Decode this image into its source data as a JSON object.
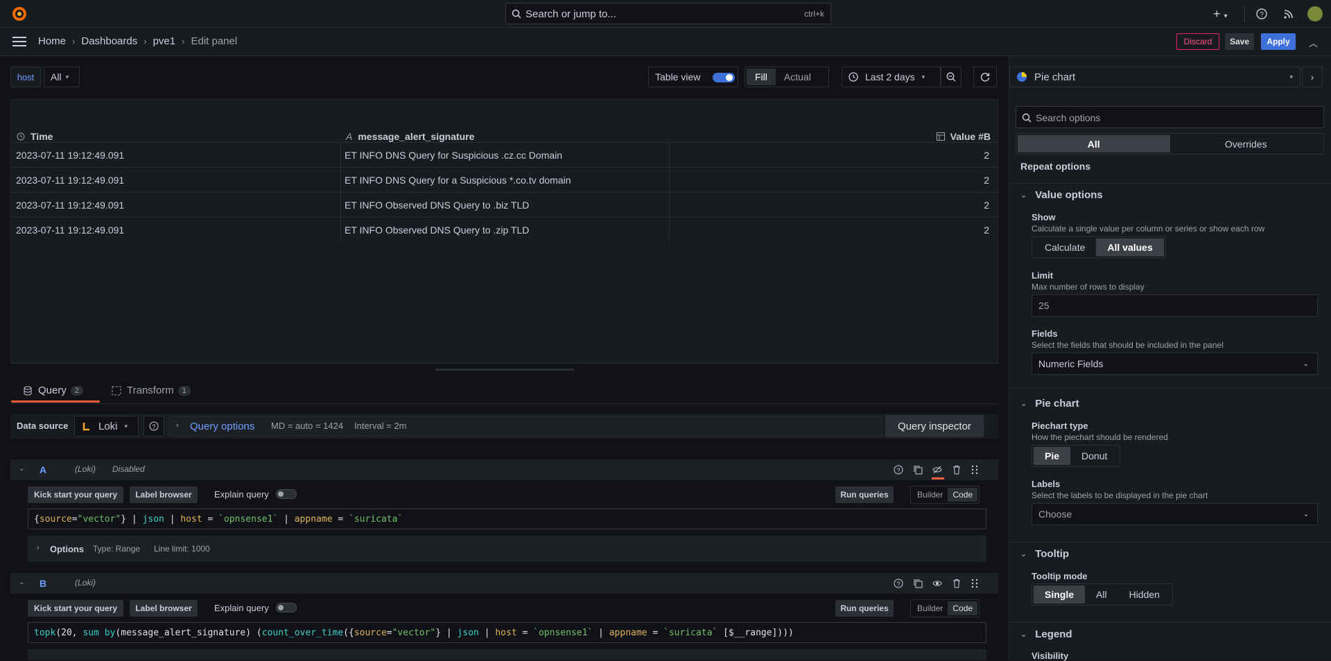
{
  "search": {
    "placeholder": "Search or jump to...",
    "shortcut": "ctrl+k"
  },
  "breadcrumb": {
    "home": "Home",
    "dashboards": "Dashboards",
    "dashboard": "pve1",
    "current": "Edit panel"
  },
  "toolbar": {
    "discard": "Discard",
    "save": "Save",
    "apply": "Apply"
  },
  "panel_controls": {
    "variable_label": "host",
    "variable_value": "All",
    "table_view": "Table view",
    "fill": "Fill",
    "actual": "Actual",
    "time_range": "Last 2 days"
  },
  "table": {
    "columns": [
      "Time",
      "message_alert_signature",
      "Value #B"
    ],
    "rows": [
      [
        "2023-07-11 19:12:49.091",
        "ET INFO DNS Query for Suspicious .cz.cc Domain",
        "2"
      ],
      [
        "2023-07-11 19:12:49.091",
        "ET INFO DNS Query for a Suspicious *.co.tv domain",
        "2"
      ],
      [
        "2023-07-11 19:12:49.091",
        "ET INFO Observed DNS Query to .biz TLD",
        "2"
      ],
      [
        "2023-07-11 19:12:49.091",
        "ET INFO Observed DNS Query to .zip TLD",
        "2"
      ]
    ]
  },
  "query_tabs": {
    "query": "Query",
    "query_count": "2",
    "transform": "Transform",
    "transform_count": "1"
  },
  "datasource": {
    "label": "Data source",
    "name": "Loki",
    "options": "Query options",
    "md": "MD = auto = 1424",
    "interval": "Interval = 2m",
    "inspector": "Query inspector"
  },
  "queries": [
    {
      "letter": "A",
      "source": "(Loki)",
      "status": "Disabled",
      "kick": "Kick start your query",
      "label_browser": "Label browser",
      "explain": "Explain query",
      "run": "Run queries",
      "builder": "Builder",
      "code": "Code",
      "options": "Options",
      "type": "Type: Range",
      "limit": "Line limit: 1000"
    },
    {
      "letter": "B",
      "source": "(Loki)",
      "kick": "Kick start your query",
      "label_browser": "Label browser",
      "explain": "Explain query",
      "run": "Run queries",
      "builder": "Builder",
      "code": "Code"
    }
  ],
  "viz": {
    "name": "Pie chart",
    "search_placeholder": "Search options",
    "tab_all": "All",
    "tab_overrides": "Overrides"
  },
  "options": {
    "repeat": "Repeat options",
    "value_options": "Value options",
    "show_label": "Show",
    "show_desc": "Calculate a single value per column or series or show each row",
    "show_calc": "Calculate",
    "show_all": "All values",
    "limit_label": "Limit",
    "limit_desc": "Max number of rows to display",
    "limit_value": "25",
    "fields_label": "Fields",
    "fields_desc": "Select the fields that should be included in the panel",
    "fields_value": "Numeric Fields",
    "pie_section": "Pie chart",
    "pie_type_label": "Piechart type",
    "pie_type_desc": "How the piechart should be rendered",
    "pie": "Pie",
    "donut": "Donut",
    "labels_label": "Labels",
    "labels_desc": "Select the labels to be displayed in the pie chart",
    "labels_value": "Choose",
    "tooltip_section": "Tooltip",
    "tooltip_mode": "Tooltip mode",
    "single": "Single",
    "all": "All",
    "hidden": "Hidden",
    "legend_section": "Legend",
    "visibility": "Visibility"
  }
}
